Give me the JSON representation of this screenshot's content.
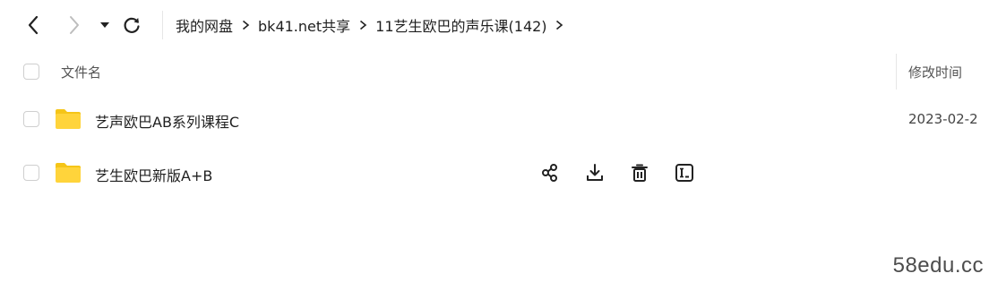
{
  "nav": {
    "back_icon": "chevron-left-icon",
    "forward_icon": "chevron-right-icon",
    "dropdown_icon": "caret-down-icon",
    "refresh_icon": "refresh-icon"
  },
  "breadcrumb": {
    "items": [
      "我的网盘",
      "bk41.net共享",
      "11艺生欧巴的声乐课(142)"
    ],
    "separator": ">"
  },
  "list": {
    "header": {
      "name": "文件名",
      "modified": "修改时间"
    },
    "rows": [
      {
        "icon": "folder-icon",
        "name": "艺声欧巴AB系列课程C",
        "modified": "2023-02-2"
      },
      {
        "icon": "folder-icon",
        "name": "艺生欧巴新版A+B",
        "modified": "",
        "actions": [
          "share-icon",
          "download-icon",
          "delete-icon",
          "rename-icon"
        ]
      }
    ]
  },
  "watermark": "58edu.cc",
  "colors": {
    "folder": "#FFD43B",
    "folder_tab": "#F5C518",
    "text": "#1f1f1f",
    "muted_text": "#555555",
    "divider": "#e6e6e6"
  }
}
